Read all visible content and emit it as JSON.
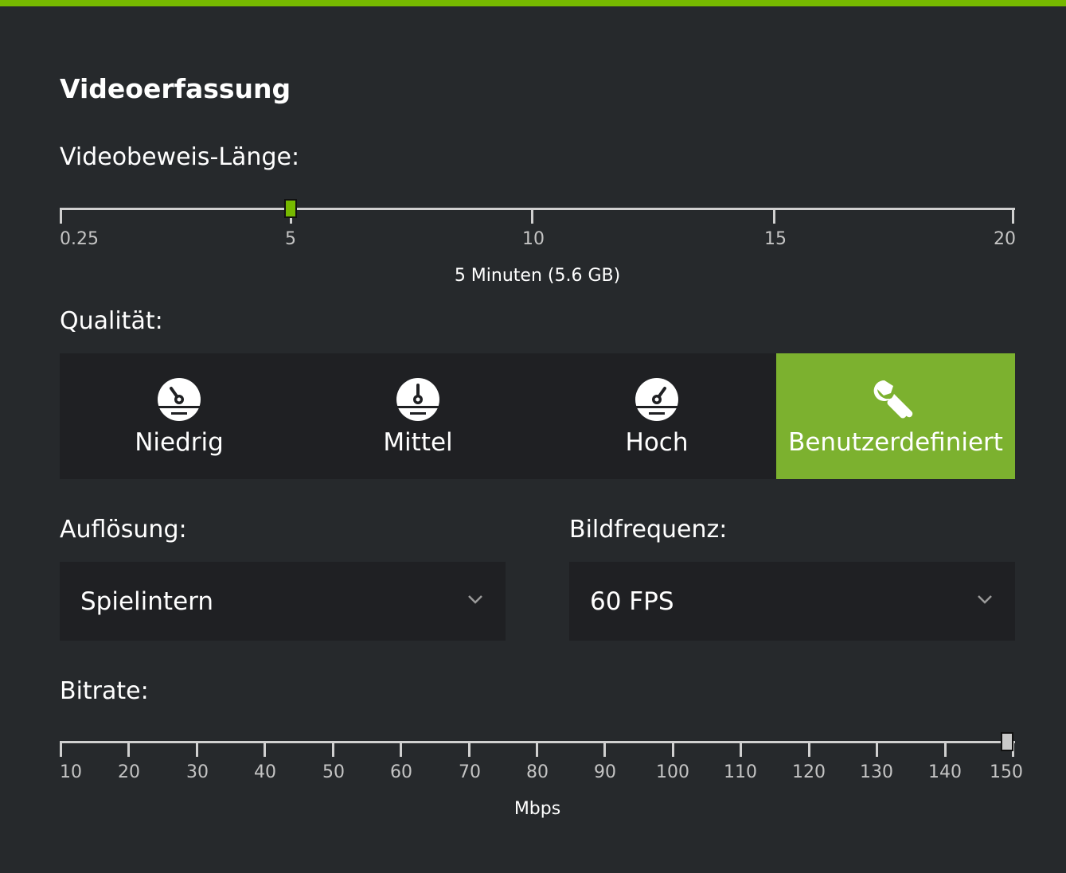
{
  "section": {
    "title": "Videoerfassung"
  },
  "replay_length": {
    "label": "Videobeweis-Länge:",
    "ticks": [
      "0.25",
      "5",
      "10",
      "15",
      "20"
    ],
    "value": 5,
    "min": 0.25,
    "max": 20,
    "caption": "5 Minuten (5.6 GB)"
  },
  "quality": {
    "label": "Qualität:",
    "options": [
      {
        "label": "Niedrig",
        "icon": "gauge-low-icon"
      },
      {
        "label": "Mittel",
        "icon": "gauge-medium-icon"
      },
      {
        "label": "Hoch",
        "icon": "gauge-high-icon"
      },
      {
        "label": "Benutzerdefiniert",
        "icon": "wrench-icon"
      }
    ],
    "selected": "Benutzerdefiniert"
  },
  "resolution": {
    "label": "Auflösung:",
    "value": "Spielintern"
  },
  "framerate": {
    "label": "Bildfrequenz:",
    "value": "60 FPS"
  },
  "bitrate": {
    "label": "Bitrate:",
    "ticks": [
      "10",
      "20",
      "30",
      "40",
      "50",
      "60",
      "70",
      "80",
      "90",
      "100",
      "110",
      "120",
      "130",
      "140",
      "150"
    ],
    "value": 150,
    "min": 10,
    "max": 150,
    "caption": "Mbps"
  },
  "colors": {
    "accent": "#76b900",
    "active_button": "#7cb12f",
    "background": "#26292c",
    "panel": "#1f2023"
  }
}
